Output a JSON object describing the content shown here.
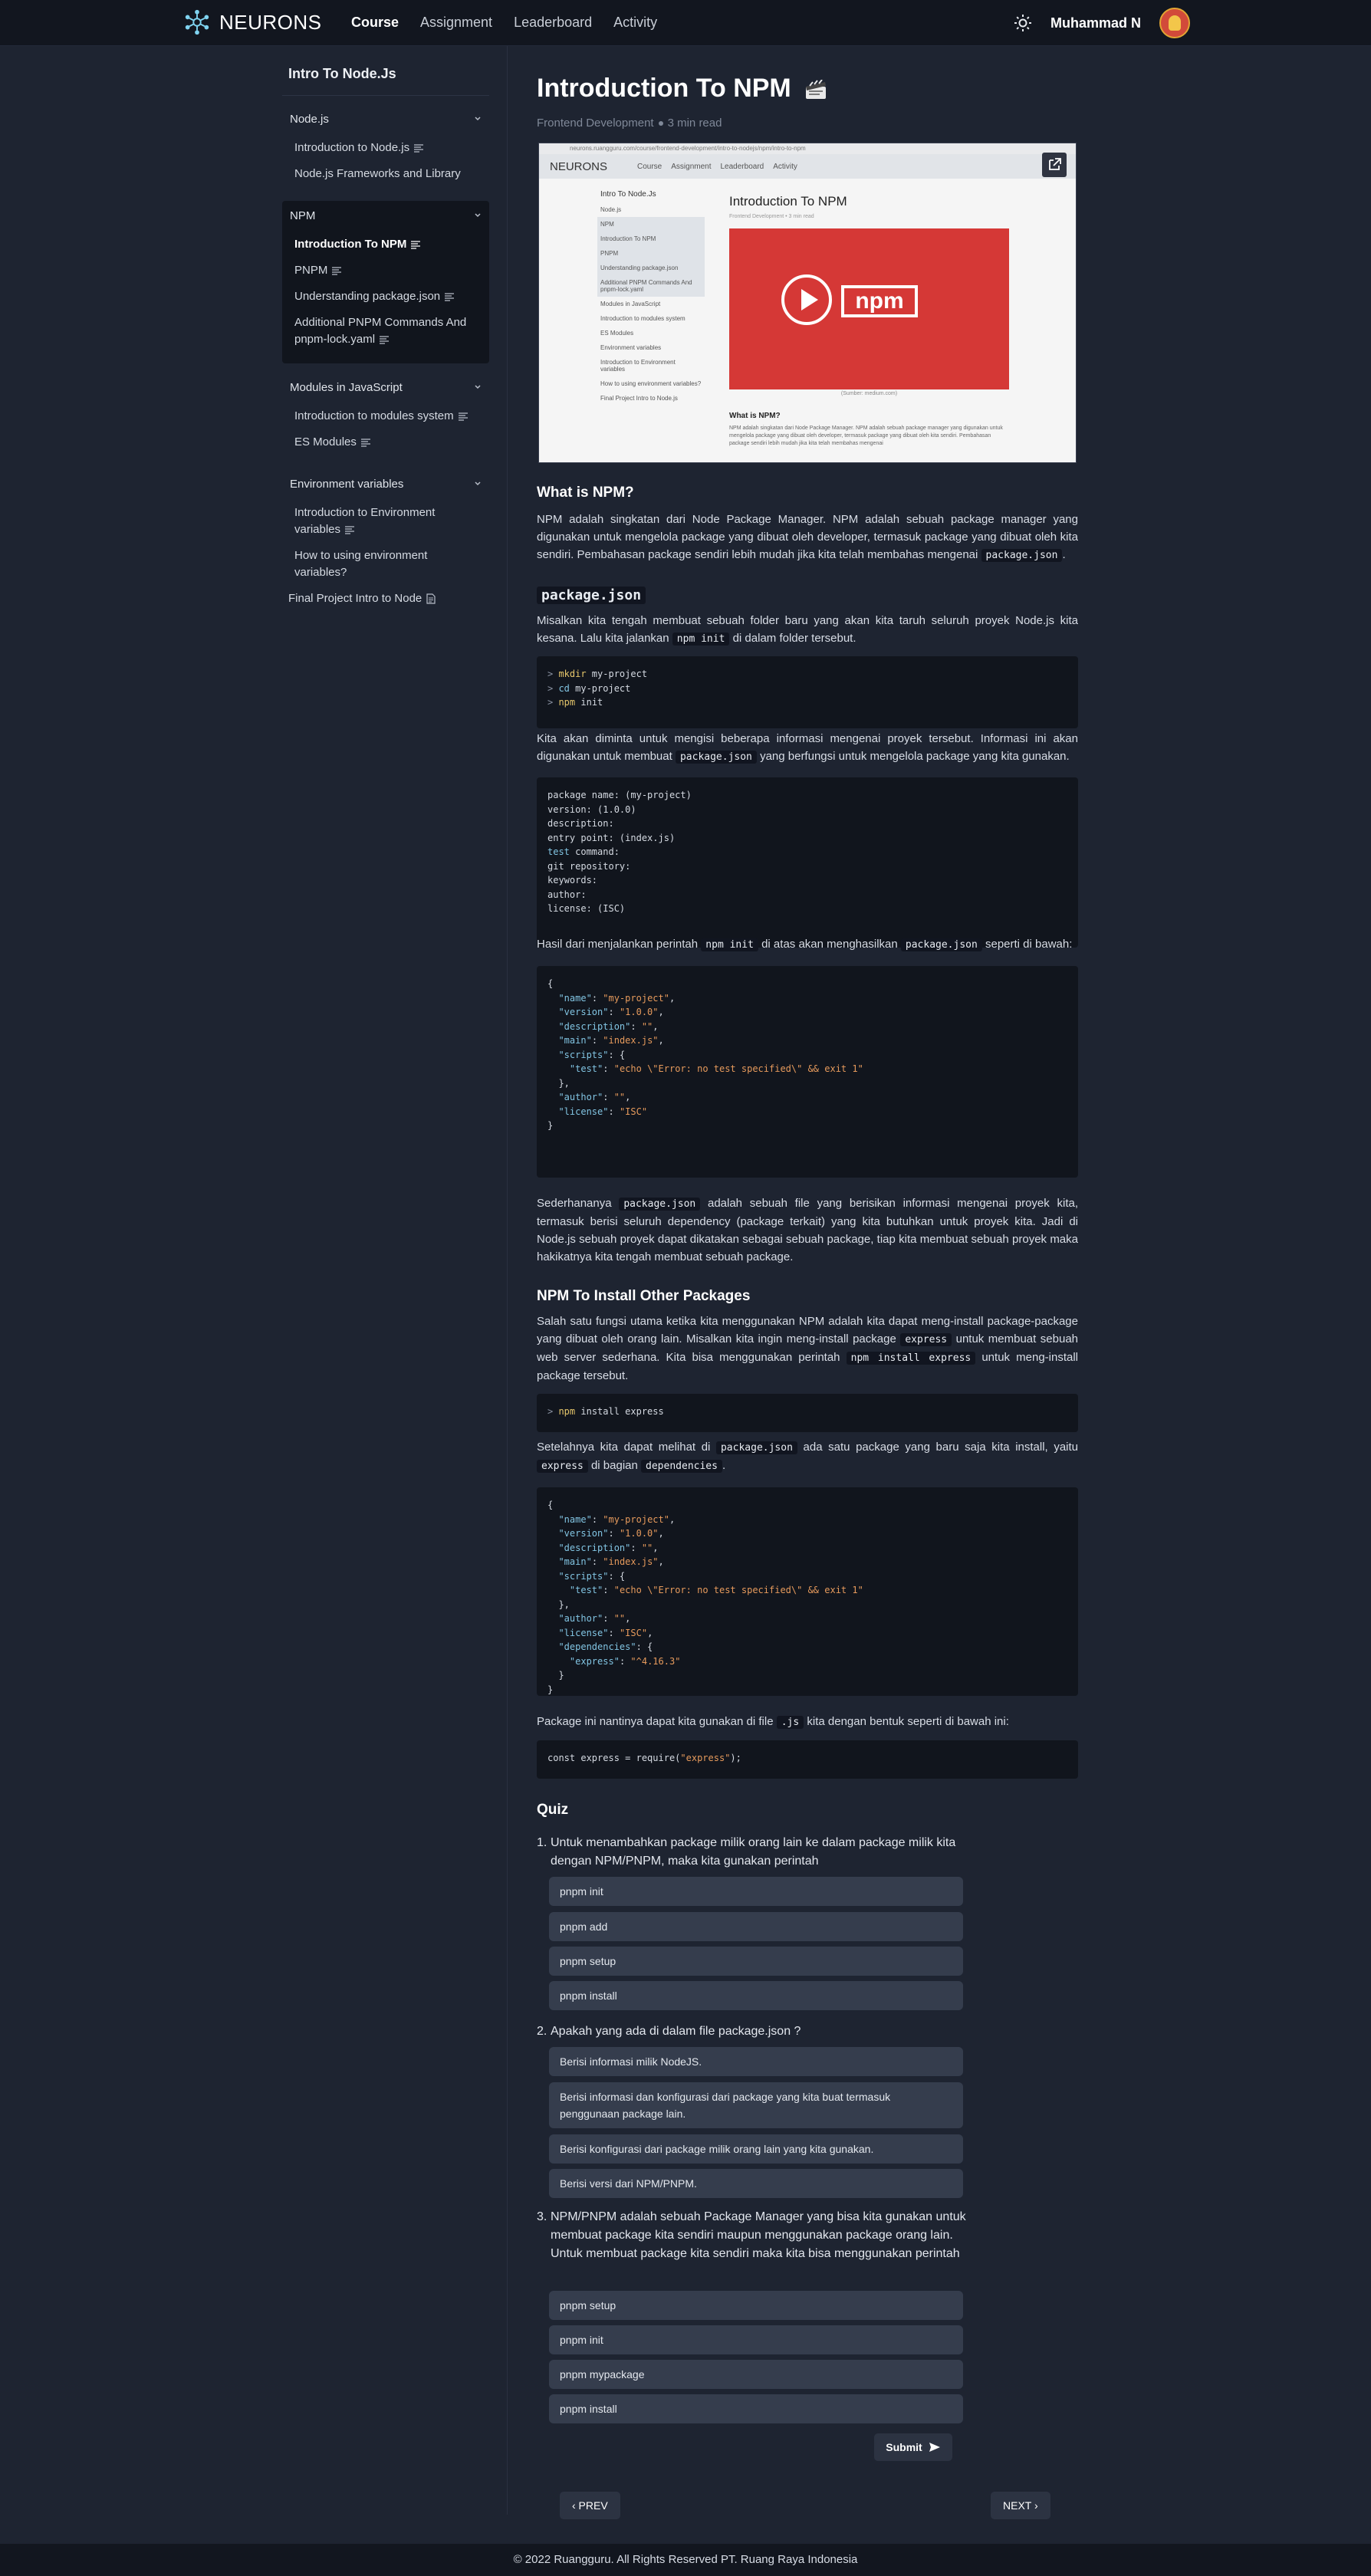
{
  "nav": {
    "brand": "NEURONS",
    "links": [
      "Course",
      "Assignment",
      "Leaderboard",
      "Activity"
    ],
    "active": "Course",
    "user": "Muhammad N",
    "theme_icon": "sun-icon"
  },
  "sidebar": {
    "title": "Intro To Node.Js",
    "sections": [
      {
        "name": "Node.js",
        "items": [
          "Introduction to Node.js",
          "Node.js Frameworks and Library"
        ]
      },
      {
        "name": "NPM",
        "items": [
          "Introduction To NPM",
          "PNPM",
          "Understanding package.json",
          "Additional PNPM Commands And pnpm-lock.yaml"
        ],
        "current": "Introduction To NPM"
      },
      {
        "name": "Modules in JavaScript",
        "items": [
          "Introduction to modules system",
          "ES Modules"
        ]
      },
      {
        "name": "Environment variables",
        "items": [
          "Introduction to Environment variables",
          "How to using environment variables?"
        ]
      }
    ],
    "final": "Final Project Intro to Node"
  },
  "article": {
    "title": "Introduction To NPM",
    "category": "Frontend Development",
    "read_time": "3 min read",
    "screenshot": {
      "url": "neurons.ruangguru.com/course/frontend-development/intro-to-nodejs/npm/intro-to-npm",
      "brand": "NEURONS",
      "links": [
        "Course",
        "Assignment",
        "Leaderboard",
        "Activity"
      ],
      "side": [
        "Intro To Node.Js",
        "Node.js",
        "NPM",
        "Introduction To NPM",
        "PNPM",
        "Understanding package.json",
        "Additional PNPM Commands And pnpm-lock.yaml",
        "Modules in JavaScript",
        "Introduction to modules system",
        "ES Modules",
        "Environment variables",
        "Introduction to Environment variables",
        "How to using environment variables?",
        "Final Project Intro to Node.js"
      ],
      "title": "Introduction To NPM",
      "meta": "Frontend Development • 3 min read",
      "caption": "(Sumber: medium.com)",
      "what": "What is NPM?",
      "body": "NPM adalah singkatan dari Node Package Manager. NPM adalah sebuah package manager yang digunakan untuk mengelola package yang dibuat oleh developer, termasuk package yang dibuat oleh kita sendiri. Pembahasan package sendiri lebih mudah jika kita telah membahas mengenai"
    },
    "h_what": "What is NPM?",
    "p_what": "NPM adalah singkatan dari Node Package Manager. NPM adalah sebuah package manager yang digunakan untuk mengelola package yang dibuat oleh developer, termasuk package yang dibuat oleh kita sendiri. Pembahasan package sendiri lebih mudah jika kita telah membahas mengenai",
    "p_what_code": "package.json",
    "h_pkg": "package.json",
    "p_pkg_1a": "Misalkan kita tengah membuat sebuah folder baru yang akan kita taruh seluruh proyek Node.js kita kesana. Lalu kita jalankan",
    "p_pkg_1_code": "npm init",
    "p_pkg_1b": "di dalam folder tersebut.",
    "p_pkg_2a": "Kita akan diminta untuk mengisi beberapa informasi mengenai proyek tersebut. Informasi ini akan digunakan untuk membuat",
    "p_pkg_2_code": "package.json",
    "p_pkg_2b": "yang berfungsi untuk mengelola package yang kita gunakan.",
    "p_pkg_3a": "Hasil dari menjalankan perintah",
    "p_pkg_3_code1": "npm init",
    "p_pkg_3b": "di atas akan menghasilkan",
    "p_pkg_3_code2": "package.json",
    "p_pkg_3c": "seperti di bawah:",
    "p_pkg_4a": "Sederhananya",
    "p_pkg_4_code": "package.json",
    "p_pkg_4b": "adalah sebuah file yang berisikan informasi mengenai proyek kita, termasuk berisi seluruh dependency (package terkait) yang kita butuhkan untuk proyek kita. Jadi di Node.js sebuah proyek dapat dikatakan sebagai sebuah package, tiap kita membuat sebuah proyek maka hakikatnya kita tengah membuat sebuah package.",
    "h_install": "NPM To Install Other Packages",
    "p_inst_1a": "Salah satu fungsi utama ketika kita menggunakan NPM adalah kita dapat meng-install package-package yang dibuat oleh orang lain. Misalkan kita ingin meng-install package",
    "p_inst_1_code1": "express",
    "p_inst_1b": "untuk membuat sebuah web server sederhana. Kita bisa menggunakan perintah",
    "p_inst_1_code2": "npm install express",
    "p_inst_1c": "untuk meng-install package tersebut.",
    "p_inst_2a": "Setelahnya kita dapat melihat di",
    "p_inst_2_code1": "package.json",
    "p_inst_2b": "ada satu package yang baru saja kita install, yaitu",
    "p_inst_2_code2": "express",
    "p_inst_2c": "di bagian",
    "p_inst_2_code3": "dependencies",
    "p_inst_2d": ".",
    "p_inst_3a": "Package ini nantinya dapat kita gunakan di file",
    "p_inst_3_code": ".js",
    "p_inst_3b": "kita dengan bentuk seperti di bawah ini:",
    "code_init": [
      "> mkdir my-project",
      "> cd my-project",
      "> npm init"
    ],
    "code_prompt": [
      "package name: (my-project)",
      "version: (1.0.0)",
      "description:",
      "entry point: (index.js)",
      "test command:",
      "git repository:",
      "keywords:",
      "author:",
      "license: (ISC)"
    ],
    "code_install": "> npm install express",
    "code_require": "const express = require(\"express\");"
  },
  "quiz": {
    "title": "Quiz",
    "questions": [
      {
        "num": "1.",
        "text": "Untuk menambahkan package milik orang lain ke dalam package milik kita dengan NPM/PNPM, maka kita gunakan perintah",
        "options": [
          "pnpm init",
          "pnpm add",
          "pnpm setup",
          "pnpm install"
        ]
      },
      {
        "num": "2.",
        "text": "Apakah yang ada di dalam file package.json ?",
        "options": [
          "Berisi informasi milik NodeJS.",
          "Berisi informasi dan konfigurasi dari package yang kita buat termasuk penggunaan package lain.",
          "Berisi konfigurasi dari package milik orang lain yang kita gunakan.",
          "Berisi versi dari NPM/PNPM."
        ]
      },
      {
        "num": "3.",
        "text": "NPM/PNPM adalah sebuah Package Manager yang bisa kita gunakan untuk membuat package kita sendiri maupun menggunakan package orang lain. Untuk membuat package kita sendiri maka kita bisa menggunakan perintah",
        "options": [
          "pnpm setup",
          "pnpm init",
          "pnpm mypackage",
          "pnpm install"
        ]
      }
    ],
    "submit": "Submit"
  },
  "pager": {
    "prev": "‹ PREV",
    "next": "NEXT ›"
  },
  "footer": "© 2022 Ruangguru. All Rights Reserved PT. Ruang Raya Indonesia"
}
